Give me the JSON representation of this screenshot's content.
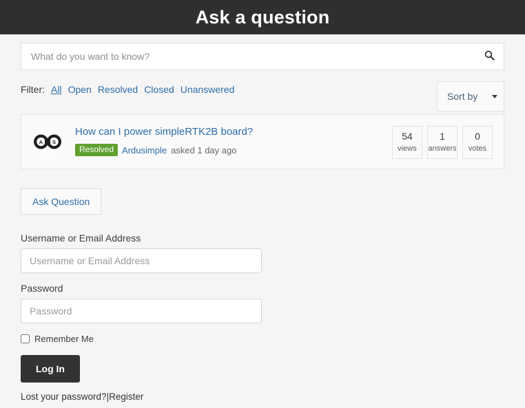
{
  "header": {
    "title": "Ask a question",
    "background": "#2f2f2f",
    "text_color": "#ffffff"
  },
  "search": {
    "placeholder": "What do you want to know?",
    "value": "",
    "icon": "search-icon"
  },
  "filter": {
    "label": "Filter:",
    "items": [
      {
        "label": "All",
        "active": true
      },
      {
        "label": "Open",
        "active": false
      },
      {
        "label": "Resolved",
        "active": false
      },
      {
        "label": "Closed",
        "active": false
      },
      {
        "label": "Unanswered",
        "active": false
      }
    ],
    "link_color": "#2e6da8"
  },
  "sort": {
    "label": "Sort by",
    "icon": "chevron-down-icon"
  },
  "questions": [
    {
      "avatar_icon": "ardusimple-infinity-logo-icon",
      "avatar_letters": [
        "A",
        "S"
      ],
      "title": "How can I power simpleRTK2B board?",
      "status_badge": "Resolved",
      "status_color": "#60a02e",
      "author": "Ardusimple",
      "asked_text": "asked 1 day ago",
      "stats": [
        {
          "num": "54",
          "label": "views"
        },
        {
          "num": "1",
          "label": "answers"
        },
        {
          "num": "0",
          "label": "votes"
        }
      ]
    }
  ],
  "ask_question_button": "Ask Question",
  "login": {
    "username": {
      "label": "Username or Email Address",
      "placeholder": "Username or Email Address",
      "value": ""
    },
    "password": {
      "label": "Password",
      "placeholder": "Password",
      "value": ""
    },
    "remember_me": {
      "label": "Remember Me",
      "checked": false
    },
    "submit_label": "Log In",
    "lost_password_label": "Lost your password?",
    "separator": "|",
    "register_label": "Register"
  }
}
